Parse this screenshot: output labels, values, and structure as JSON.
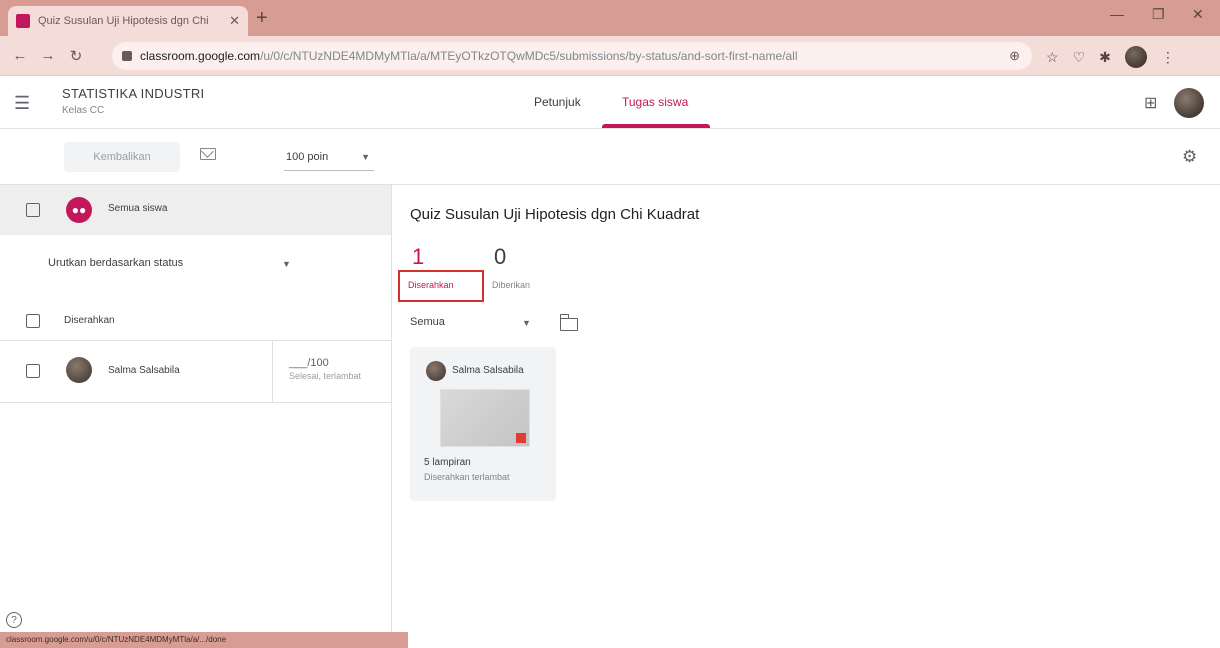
{
  "browser": {
    "tab_title": "Quiz Susulan Uji Hipotesis dgn Chi",
    "url_host": "classroom.google.com",
    "url_path": "/u/0/c/NTUzNDE4MDMyMTla/a/MTEyOTkzOTQwMDc5/submissions/by-status/and-sort-first-name/all",
    "status_url": "classroom.google.com/u/0/c/NTUzNDE4MDMyMTla/a/.../done"
  },
  "header": {
    "class_title": "STATISTIKA INDUSTRI",
    "class_subtitle": "Kelas CC",
    "tab_instructions": "Petunjuk",
    "tab_student_work": "Tugas siswa"
  },
  "actionbar": {
    "return_label": "Kembalikan",
    "points_label": "100 poin"
  },
  "left": {
    "all_students": "Semua siswa",
    "sort_label": "Urutkan berdasarkan status",
    "section_turned_in": "Diserahkan",
    "students": [
      {
        "name": "Salma Salsabila",
        "grade": "___/100",
        "status": "Selesai, terlambat"
      }
    ]
  },
  "main": {
    "assignment_title": "Quiz Susulan Uji Hipotesis dgn Chi Kuadrat",
    "stats": [
      {
        "count": "1",
        "label": "Diserahkan"
      },
      {
        "count": "0",
        "label": "Diberikan"
      }
    ],
    "filter_label": "Semua",
    "card": {
      "student": "Salma Salsabila",
      "attachments": "5 lampiran",
      "status": "Diserahkan terlambat"
    }
  },
  "colors": {
    "accent": "#c2185b",
    "highlight": "#d32f2f",
    "chrome": "#d79d95"
  }
}
